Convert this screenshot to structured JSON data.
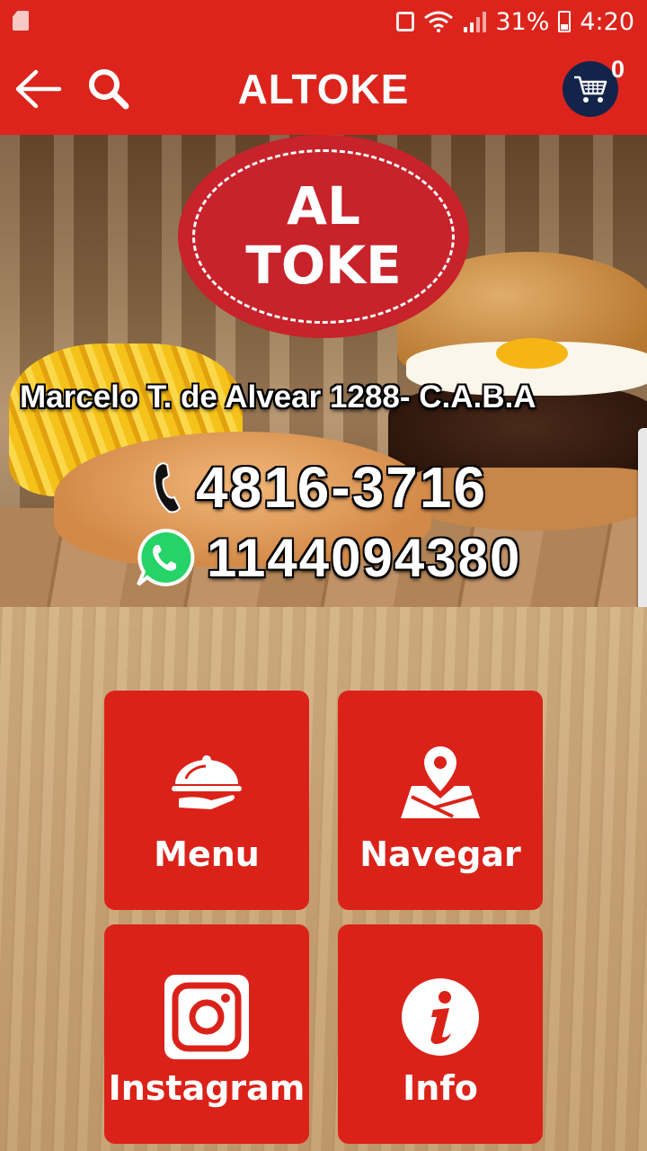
{
  "status_bar": {
    "battery": "31%",
    "time": "4:20"
  },
  "app_bar": {
    "title": "ALTOKE",
    "cart_count": "0"
  },
  "banner": {
    "logo_line1": "AL",
    "logo_line2": "TOKE",
    "address": "Marcelo T. de Alvear 1288- C.A.B.A",
    "phone": "4816-3716",
    "whatsapp": "1144094380"
  },
  "tiles": [
    {
      "label": "Menu",
      "icon": "cloche-icon"
    },
    {
      "label": "Navegar",
      "icon": "map-pin-icon"
    },
    {
      "label": "Instagram",
      "icon": "instagram-icon"
    },
    {
      "label": "Info",
      "icon": "info-icon"
    }
  ],
  "colors": {
    "primary_red": "#dc241c",
    "cart_badge": "#12244a"
  }
}
